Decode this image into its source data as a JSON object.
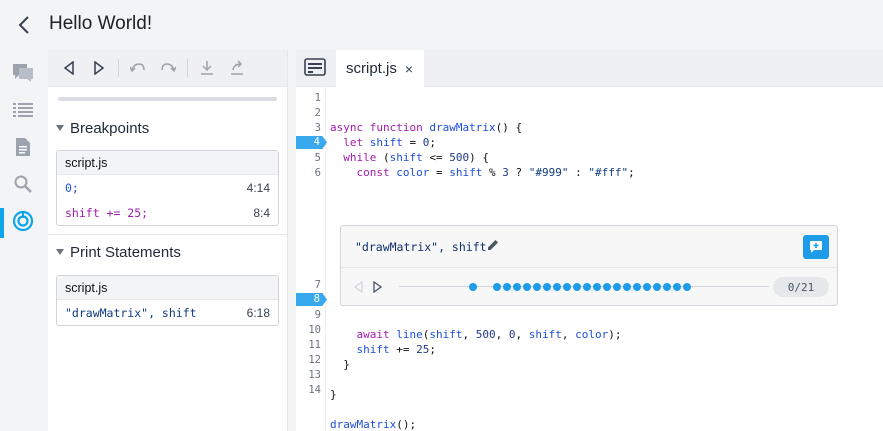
{
  "window": {
    "title": "Hello World!"
  },
  "toolbar": {
    "buttons": [
      "step-back",
      "step-forward",
      "undo",
      "redo",
      "download",
      "share"
    ]
  },
  "breakpoints": {
    "section_label": "Breakpoints",
    "file": "script.js",
    "items": [
      {
        "code": "0;",
        "location": "4:14"
      },
      {
        "code": "shift += 25;",
        "location": "8:4"
      }
    ]
  },
  "print_statements": {
    "section_label": "Print Statements",
    "file": "script.js",
    "items": [
      {
        "code": "\"drawMatrix\", shift",
        "location": "6:18"
      }
    ]
  },
  "editor": {
    "tab_label": "script.js",
    "tab_close": "×",
    "line_numbers": [
      "1",
      "2",
      "3",
      "4",
      "5",
      "6",
      "7",
      "8",
      "9",
      "10",
      "11",
      "12",
      "13",
      "14"
    ],
    "breakpoint_lines": [
      "4",
      "8"
    ],
    "print_panel": {
      "expression": "\"drawMatrix\", shift",
      "counter": "0/21",
      "hit_count": 21
    }
  },
  "colors": {
    "accent": "#1e9be9",
    "breakpoint": "#38a8ef",
    "keyword": "#a21caf",
    "identifier": "#1d4ed8"
  }
}
